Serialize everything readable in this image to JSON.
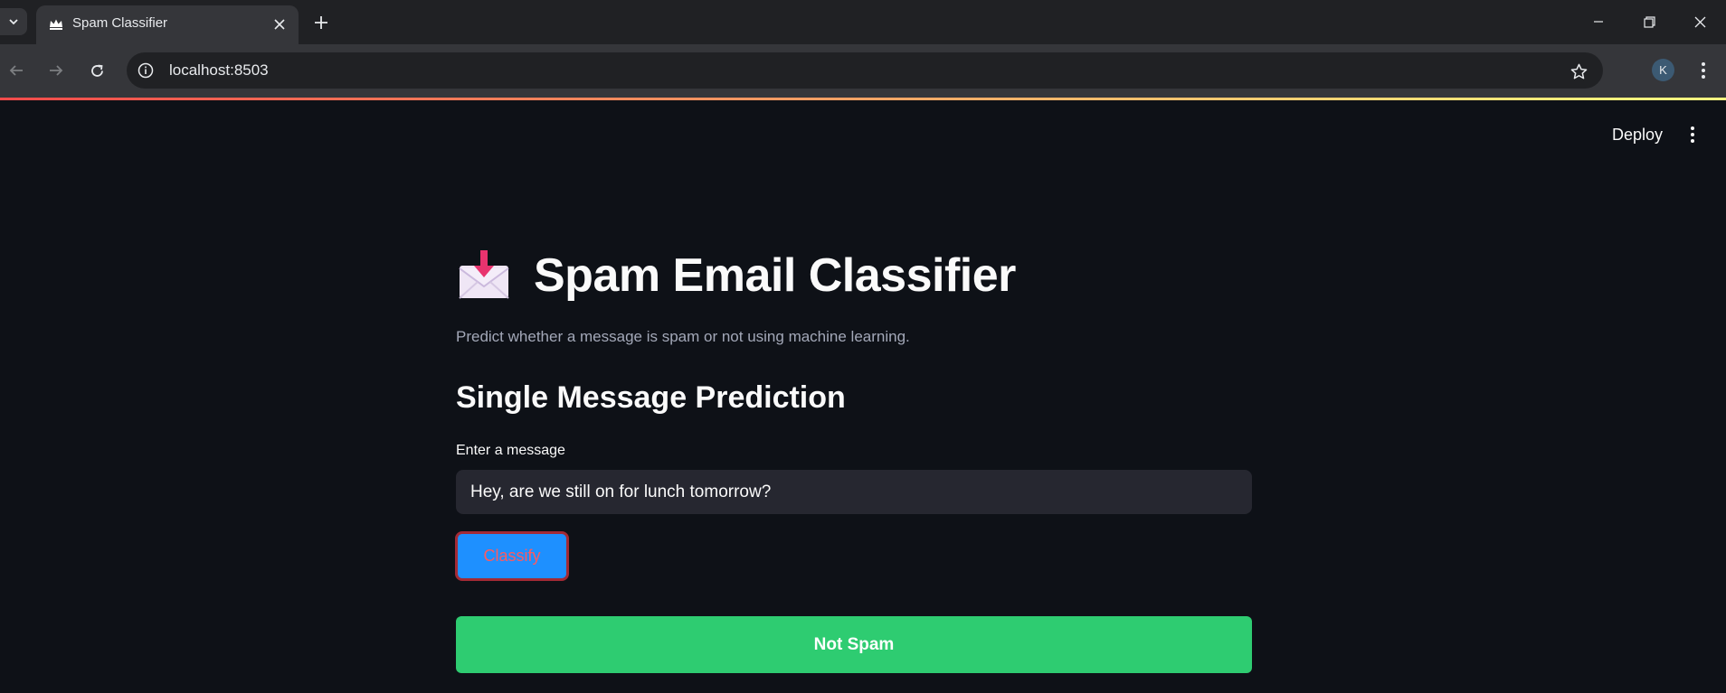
{
  "browser": {
    "tab_title": "Spam Classifier",
    "url": "localhost:8503",
    "profile_initial": "K"
  },
  "app": {
    "deploy_label": "Deploy",
    "title": "Spam Email Classifier",
    "title_icon": "incoming-envelope-emoji",
    "subtitle": "Predict whether a message is spam or not using machine learning.",
    "section_header": "Single Message Prediction",
    "input": {
      "label": "Enter a message",
      "value": "Hey, are we still on for lunch tomorrow?"
    },
    "classify_label": "Classify",
    "result_text": "Not Spam"
  },
  "colors": {
    "background": "#0e1117",
    "result_bg": "#2ecc71",
    "button_bg": "#1e90ff",
    "button_border": "#a32a35",
    "button_text": "#ff5a5f"
  }
}
